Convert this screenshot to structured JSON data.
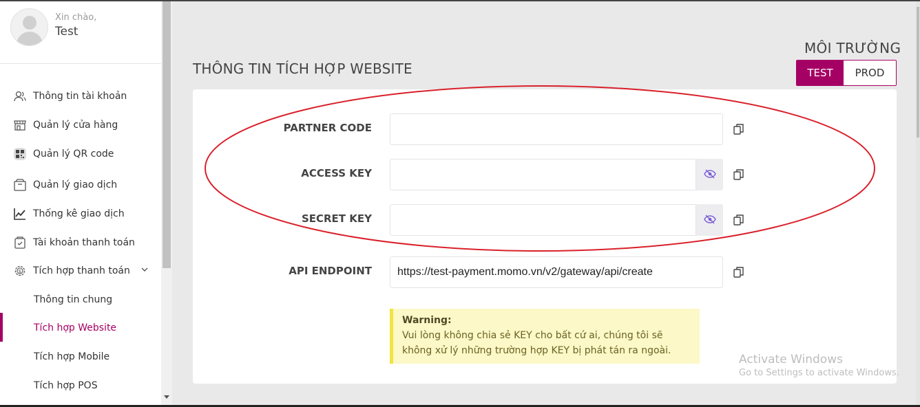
{
  "user": {
    "greeting": "Xin chào,",
    "name": "Test"
  },
  "sidebar": {
    "items": [
      {
        "label": "Thông tin tài khoản",
        "icon": "user-icon"
      },
      {
        "label": "Quản lý cửa hàng",
        "icon": "store-icon"
      },
      {
        "label": "Quản lý QR code",
        "icon": "qr-code-icon"
      },
      {
        "label": "Quản lý giao dịch",
        "icon": "box-icon"
      },
      {
        "label": "Thống kê giao dịch",
        "icon": "chart-line-icon"
      },
      {
        "label": "Tài khoản thanh toán",
        "icon": "wallet-icon"
      },
      {
        "label": "Tích hợp thanh toán",
        "icon": "gear-icon"
      }
    ],
    "sub_items": [
      {
        "label": "Thông tin chung",
        "active": false
      },
      {
        "label": "Tích hợp Website",
        "active": true
      },
      {
        "label": "Tích hợp Mobile",
        "active": false
      },
      {
        "label": "Tích hợp POS",
        "active": false
      }
    ]
  },
  "environment": {
    "title": "MÔI TRƯỜNG",
    "test_label": "TEST",
    "prod_label": "PROD",
    "selected": "TEST"
  },
  "page": {
    "title": "THÔNG TIN TÍCH HỢP WEBSITE"
  },
  "fields": {
    "partner_code": {
      "label": "PARTNER CODE",
      "value": ""
    },
    "access_key": {
      "label": "ACCESS KEY",
      "value": ""
    },
    "secret_key": {
      "label": "SECRET KEY",
      "value": ""
    },
    "api_endpoint": {
      "label": "API ENDPOINT",
      "value": "https://test-payment.momo.vn/v2/gateway/api/create"
    }
  },
  "warning": {
    "title": "Warning:",
    "line1": "Vui lòng không chia sẻ KEY cho bất cứ ai, chúng tôi sẽ",
    "line2": "không xử lý những trường hợp KEY bị phát tán ra ngoài."
  },
  "watermark": {
    "line1": "Activate Windows",
    "line2": "Go to Settings to activate Windows."
  },
  "colors": {
    "brand": "#a50064",
    "annotation": "#d9202a",
    "warning_bg": "#fcf8c7",
    "warning_border": "#f0e442"
  }
}
